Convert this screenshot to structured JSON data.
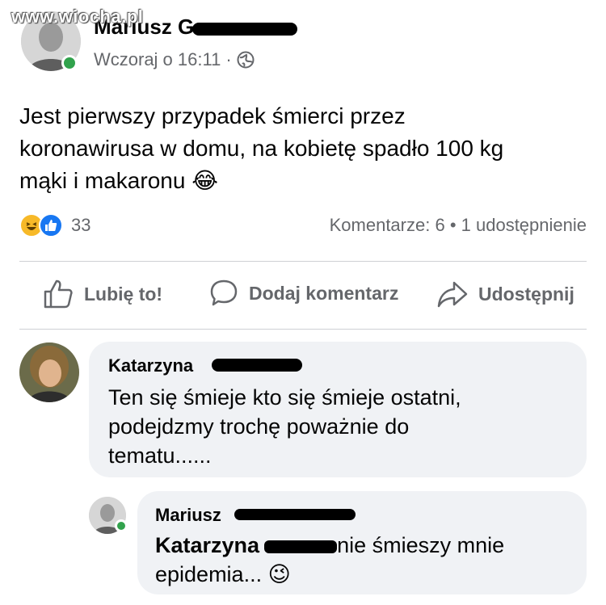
{
  "watermark": "www.wiocha.pl",
  "post": {
    "author": "Mariusz",
    "author_initial_visible": "G",
    "timestamp": "Wczoraj o 16:11",
    "separator": "·",
    "privacy_icon": "globe-icon",
    "text_line1": "Jest pierwszy przypadek śmierci przez",
    "text_line2": "koronawirusa w domu, na kobietę spadło 100 kg",
    "text_line3": "mąki i makaronu",
    "text_emoji": "😂",
    "reactions": {
      "icons": [
        "haha-reaction-icon",
        "like-reaction-icon"
      ],
      "count": "33"
    },
    "comments_stat": "Komentarze: 6",
    "stat_separator": "•",
    "shares_stat": "1 udostępnienie"
  },
  "actions": {
    "like_label": "Lubię to!",
    "comment_label": "Dodaj komentarz",
    "share_label": "Udostępnij"
  },
  "comments": [
    {
      "author": "Katarzyna",
      "line1": "Ten się śmieje kto się śmieje ostatni,",
      "line2": "podejdzmy trochę poważnie do",
      "line3": "tematu......"
    }
  ],
  "reply": {
    "author": "Mariusz",
    "mention": "Katarzyna",
    "text_after_mention": "nie śmieszy mnie",
    "line2": "epidemia...",
    "emoji": "😉"
  },
  "colors": {
    "online": "#31a24c",
    "like_blue": "#1877f2",
    "haha_yellow": "#f7b928",
    "secondary_text": "#65676b",
    "bubble_bg": "#f0f2f5"
  }
}
